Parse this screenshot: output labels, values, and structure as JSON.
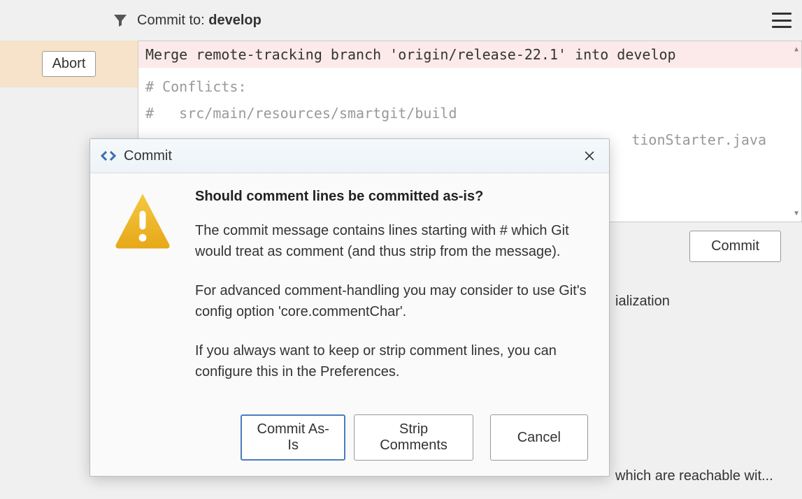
{
  "header": {
    "commit_to_prefix": "Commit to: ",
    "branch": "develop"
  },
  "sidebar": {
    "abort_label": "Abort"
  },
  "editor": {
    "lines": [
      "Merge remote-tracking branch 'origin/release-22.1' into develop",
      "",
      "# Conflicts:",
      "#   src/main/resources/smartgit/build",
      "                                       tionStarter.java"
    ]
  },
  "actions": {
    "commit_label": "Commit"
  },
  "background": {
    "text1": "ialization",
    "text2": "which are reachable wit..."
  },
  "dialog": {
    "title": "Commit",
    "heading": "Should comment lines be committed as-is?",
    "para1": "The commit message contains lines starting with # which Git would treat as comment (and thus strip from the message).",
    "para2": "For advanced comment-handling you may consider to use Git's config option 'core.commentChar'.",
    "para3": "If you always want to keep or strip comment lines, you can configure this in the Preferences.",
    "buttons": {
      "commit_as_is": "Commit As-Is",
      "strip_comments": "Strip Comments",
      "cancel": "Cancel"
    }
  }
}
